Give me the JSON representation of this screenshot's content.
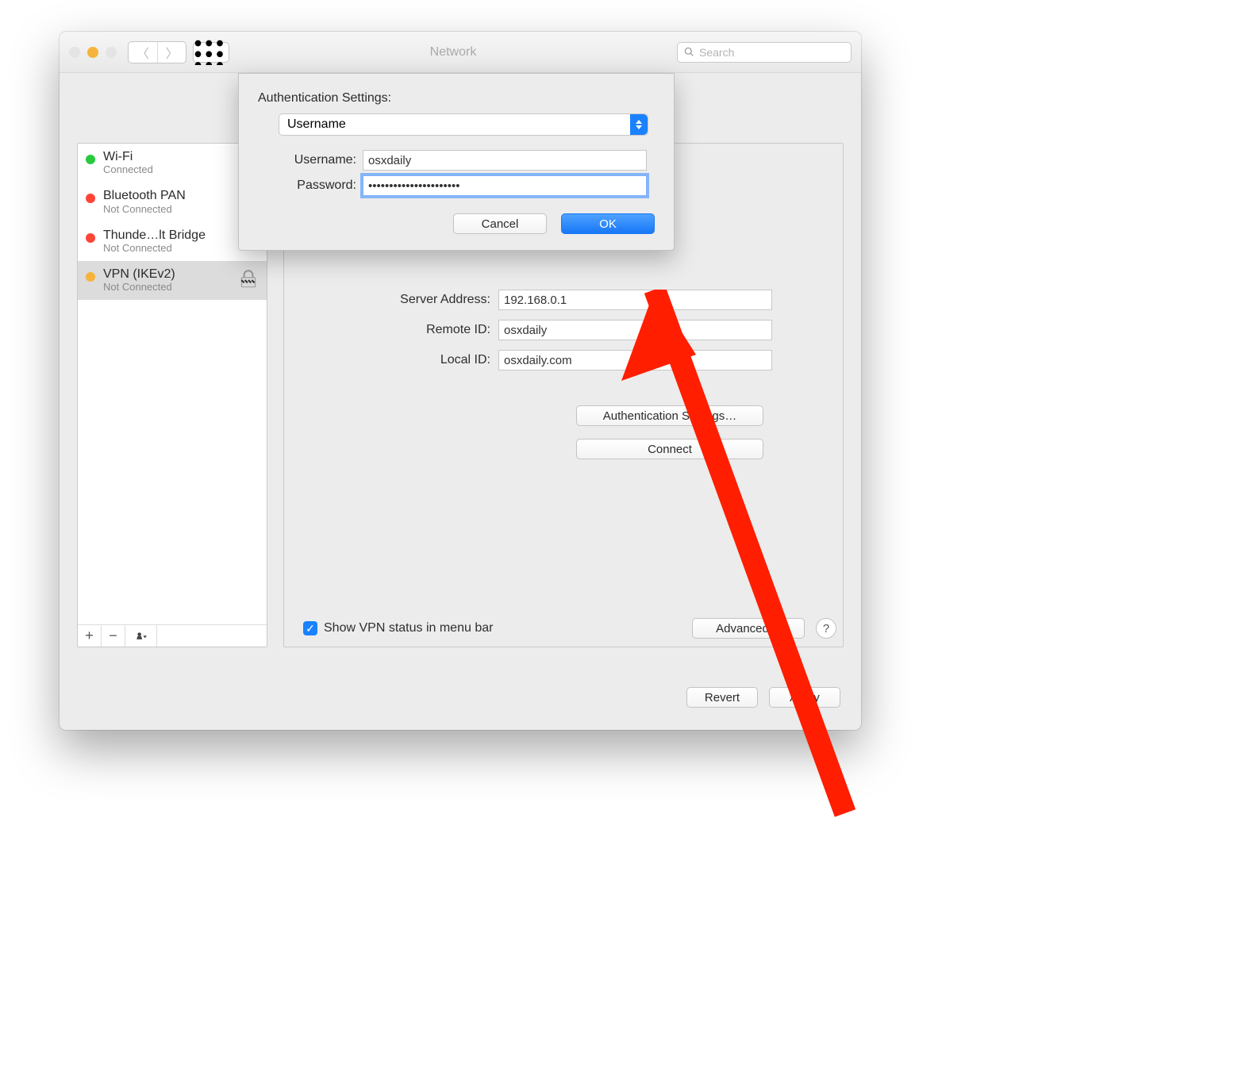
{
  "window": {
    "title": "Network",
    "search_placeholder": "Search"
  },
  "traffic": {
    "close": "#e4e4e4",
    "min": "#f6b43c",
    "max": "#e4e4e4"
  },
  "sidebar": {
    "items": [
      {
        "name": "Wi-Fi",
        "status": "Connected",
        "color": "#29c93f"
      },
      {
        "name": "Bluetooth PAN",
        "status": "Not Connected",
        "color": "#ff4438"
      },
      {
        "name": "Thunde…lt Bridge",
        "status": "Not Connected",
        "color": "#ff4438"
      },
      {
        "name": "VPN (IKEv2)",
        "status": "Not Connected",
        "color": "#f6b43c"
      }
    ],
    "tool": {
      "add": "+",
      "remove": "−"
    }
  },
  "main": {
    "server_label": "Server Address:",
    "server_value": "192.168.0.1",
    "remote_label": "Remote ID:",
    "remote_value": "osxdaily",
    "local_label": "Local ID:",
    "local_value": "osxdaily.com",
    "auth_button": "Authentication Settings…",
    "connect_button": "Connect",
    "show_menu_label": "Show VPN status in menu bar",
    "advanced_button": "Advanced…",
    "help": "?",
    "revert_button": "Revert",
    "apply_button": "Apply"
  },
  "sheet": {
    "title": "Authentication Settings:",
    "method": "Username",
    "username_label": "Username:",
    "username_value": "osxdaily",
    "password_label": "Password:",
    "password_value": "••••••••••••••••••••••",
    "cancel": "Cancel",
    "ok": "OK"
  }
}
